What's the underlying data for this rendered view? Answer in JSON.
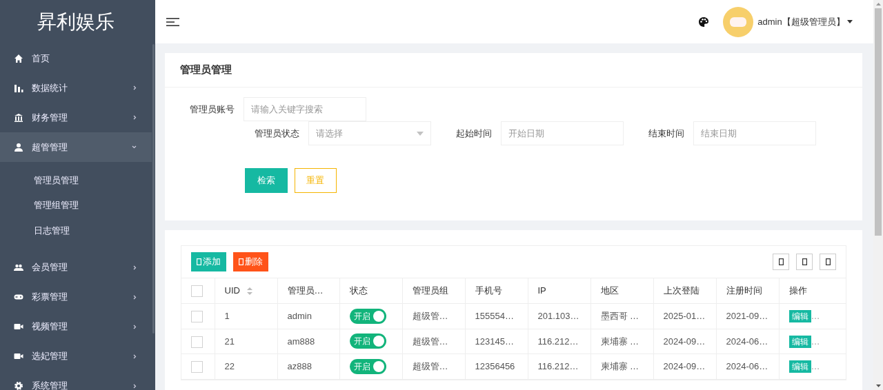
{
  "brand": "昇利娱乐",
  "sidebar": {
    "items": [
      {
        "label": "首页",
        "has_arrow": false,
        "selected": false
      },
      {
        "label": "数据统计",
        "has_arrow": true,
        "expanded": false,
        "selected": false
      },
      {
        "label": "财务管理",
        "has_arrow": true,
        "expanded": false,
        "selected": false
      },
      {
        "label": "超管管理",
        "has_arrow": true,
        "expanded": true,
        "selected": true,
        "children": [
          {
            "label": "管理员管理"
          },
          {
            "label": "管理组管理"
          },
          {
            "label": "日志管理"
          }
        ]
      },
      {
        "label": "会员管理",
        "has_arrow": true,
        "expanded": false,
        "selected": false
      },
      {
        "label": "彩票管理",
        "has_arrow": true,
        "expanded": false,
        "selected": false
      },
      {
        "label": "视频管理",
        "has_arrow": true,
        "expanded": false,
        "selected": false
      },
      {
        "label": "选妃管理",
        "has_arrow": true,
        "expanded": false,
        "selected": false
      },
      {
        "label": "系统管理",
        "has_arrow": true,
        "expanded": false,
        "selected": false
      }
    ]
  },
  "header": {
    "user": "admin【超级管理员】"
  },
  "filter_card": {
    "title": "管理员管理",
    "fields": [
      {
        "label": "管理员账号",
        "placeholder": "请输入关键字搜索",
        "kind": "text"
      },
      {
        "label": "管理员状态",
        "placeholder": "请选择",
        "kind": "select"
      },
      {
        "label": "起始时间",
        "placeholder": "开始日期",
        "kind": "text"
      },
      {
        "label": "结束时间",
        "placeholder": "结束日期",
        "kind": "text"
      }
    ],
    "search_button": "检索",
    "reset_button": "重置"
  },
  "table": {
    "header_checked": false,
    "add_button": "添加",
    "delete_button": "删除",
    "columns": [
      "UID",
      "管理员…",
      "状态",
      "管理员组",
      "手机号",
      "IP",
      "地区",
      "上次登陆",
      "注册时间",
      "操作"
    ],
    "rows": [
      {
        "checked": false,
        "uid": "1",
        "name": "admin",
        "status": {
          "on": true,
          "label": "开启"
        },
        "group": "超级管…",
        "phone": "155554…",
        "ip": "201.103…",
        "region": "墨西哥 …",
        "last_login": "2025-01…",
        "registered": "2021-09…",
        "action": "编辑",
        "more": "…"
      },
      {
        "checked": false,
        "uid": "21",
        "name": "am888",
        "status": {
          "on": true,
          "label": "开启"
        },
        "group": "超级管…",
        "phone": "123145…",
        "ip": "116.212…",
        "region": "柬埔寨 …",
        "last_login": "2024-09…",
        "registered": "2024-06…",
        "action": "编辑",
        "more": "…"
      },
      {
        "checked": false,
        "uid": "22",
        "name": "az888",
        "status": {
          "on": true,
          "label": "开启"
        },
        "group": "超级管…",
        "phone": "12356456",
        "ip": "116.212…",
        "region": "柬埔寨 …",
        "last_login": "2024-09…",
        "registered": "2024-06…",
        "action": "编辑",
        "more": "…"
      }
    ]
  }
}
